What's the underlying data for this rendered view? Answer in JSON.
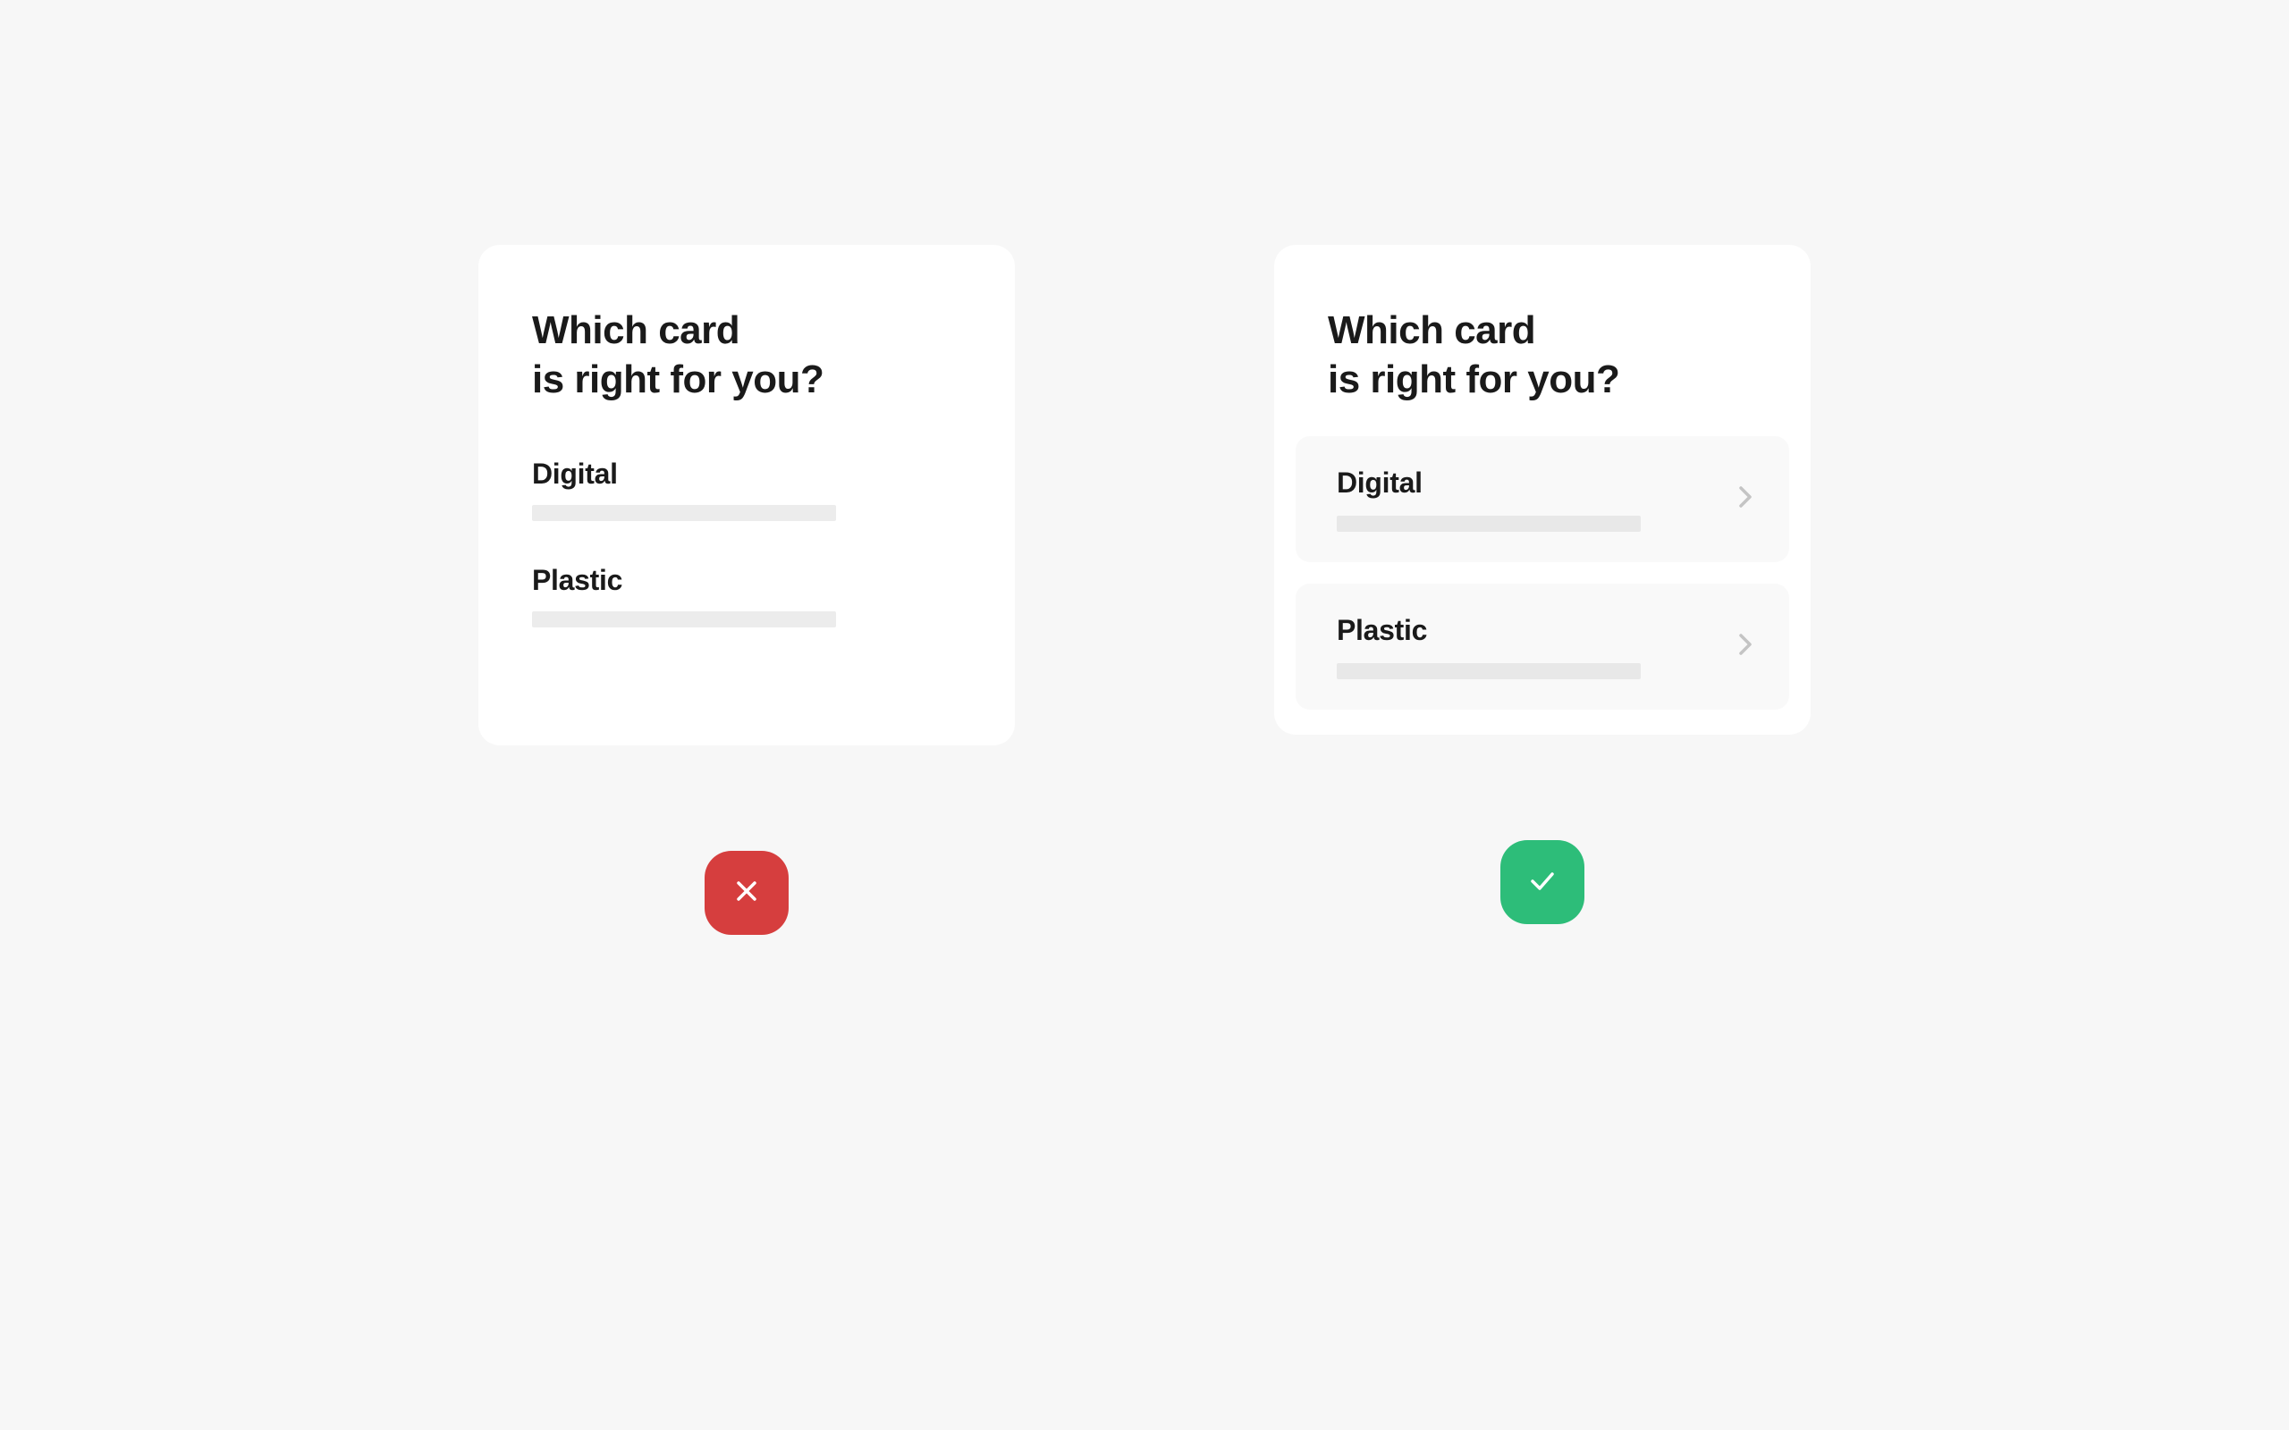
{
  "left": {
    "title_line1": "Which card",
    "title_line2": "is right for you?",
    "options": [
      {
        "label": "Digital"
      },
      {
        "label": "Plastic"
      }
    ]
  },
  "right": {
    "title_line1": "Which card",
    "title_line2": "is right for you?",
    "options": [
      {
        "label": "Digital"
      },
      {
        "label": "Plastic"
      }
    ]
  },
  "colors": {
    "bad": "#d63e3e",
    "good": "#2dbd79"
  }
}
